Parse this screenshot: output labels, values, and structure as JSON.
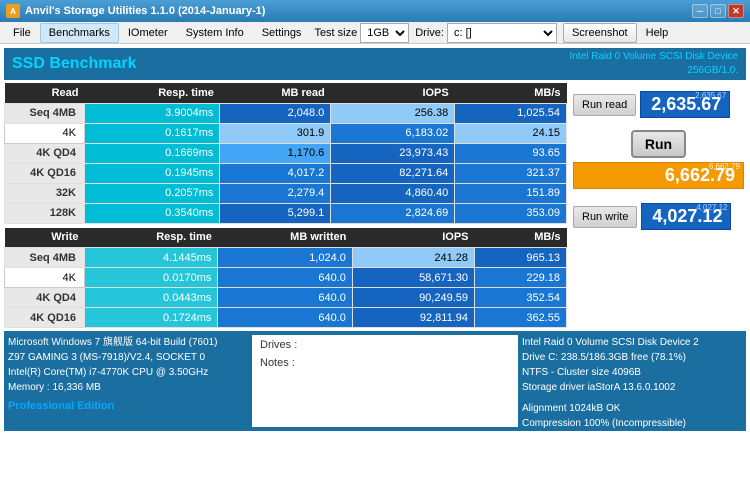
{
  "window": {
    "title": "Anvil's Storage Utilities 1.1.0 (2014-January-1)"
  },
  "menu": {
    "file": "File",
    "benchmarks": "Benchmarks",
    "iometer": "IOmeter",
    "system_info": "System Info",
    "settings": "Settings",
    "test_size_label": "Test size",
    "test_size_value": "1GB",
    "drive_label": "Drive:",
    "drive_value": "c: []",
    "screenshot": "Screenshot",
    "help": "Help"
  },
  "header": {
    "title": "SSD Benchmark",
    "device_line1": "Intel Raid 0 Volume SCSI Disk Device",
    "device_line2": "256GB/1.0."
  },
  "read_table": {
    "columns": [
      "Read",
      "Resp. time",
      "MB read",
      "IOPS",
      "MB/s"
    ],
    "rows": [
      {
        "label": "Seq 4MB",
        "resp": "3.9004ms",
        "mb": "2,048.0",
        "iops": "256.38",
        "mbs": "1,025.54"
      },
      {
        "label": "4K",
        "resp": "0.1617ms",
        "mb": "301.9",
        "iops": "6,183.02",
        "mbs": "24.15"
      },
      {
        "label": "4K QD4",
        "resp": "0.1669ms",
        "mb": "1,170.6",
        "iops": "23,973.43",
        "mbs": "93.65"
      },
      {
        "label": "4K QD16",
        "resp": "0.1945ms",
        "mb": "4,017.2",
        "iops": "82,271.64",
        "mbs": "321.37"
      },
      {
        "label": "32K",
        "resp": "0.2057ms",
        "mb": "2,279.4",
        "iops": "4,860.40",
        "mbs": "151.89"
      },
      {
        "label": "128K",
        "resp": "0.3540ms",
        "mb": "5,299.1",
        "iops": "2,824.69",
        "mbs": "353.09"
      }
    ]
  },
  "write_table": {
    "columns": [
      "Write",
      "Resp. time",
      "MB written",
      "IOPS",
      "MB/s"
    ],
    "rows": [
      {
        "label": "Seq 4MB",
        "resp": "4.1445ms",
        "mb": "1,024.0",
        "iops": "241.28",
        "mbs": "965.13"
      },
      {
        "label": "4K",
        "resp": "0.0170ms",
        "mb": "640.0",
        "iops": "58,671.30",
        "mbs": "229.18"
      },
      {
        "label": "4K QD4",
        "resp": "0.0443ms",
        "mb": "640.0",
        "iops": "90,249.59",
        "mbs": "352.54"
      },
      {
        "label": "4K QD16",
        "resp": "0.1724ms",
        "mb": "640.0",
        "iops": "92,811.94",
        "mbs": "362.55"
      }
    ]
  },
  "scores": {
    "run_read_label": "Run read",
    "run_write_label": "Run write",
    "run_label": "Run",
    "read_score_top": "2,635.67",
    "read_score_main": "2,635.67",
    "total_score_top": "6,662.79",
    "total_score_main": "6,662.79",
    "write_score_top": "4,027.12",
    "write_score_main": "4,027.12"
  },
  "system_info": {
    "os": "Microsoft Windows 7 旗舰版 64-bit Build (7601)",
    "mb": "Z97 GAMING 3 (MS-7918)/V2.4, SOCKET 0",
    "cpu": "Intel(R) Core(TM) i7-4770K CPU @ 3.50GHz",
    "memory": "Memory : 16,336 MB",
    "edition": "Professional Edition"
  },
  "drives_notes": {
    "drives_label": "Drives :",
    "notes_label": "Notes :"
  },
  "device_info": {
    "line1": "Intel Raid 0 Volume SCSI Disk Device 2",
    "line2": "Drive C: 238.5/186.3GB free (78.1%)",
    "line3": "NTFS - Cluster size 4096B",
    "line4": "Storage driver  iaStorA 13.6.0.1002",
    "line5": "",
    "line6": "Alignment 1024kB OK",
    "line7": "Compression 100% (Incompressible)"
  }
}
